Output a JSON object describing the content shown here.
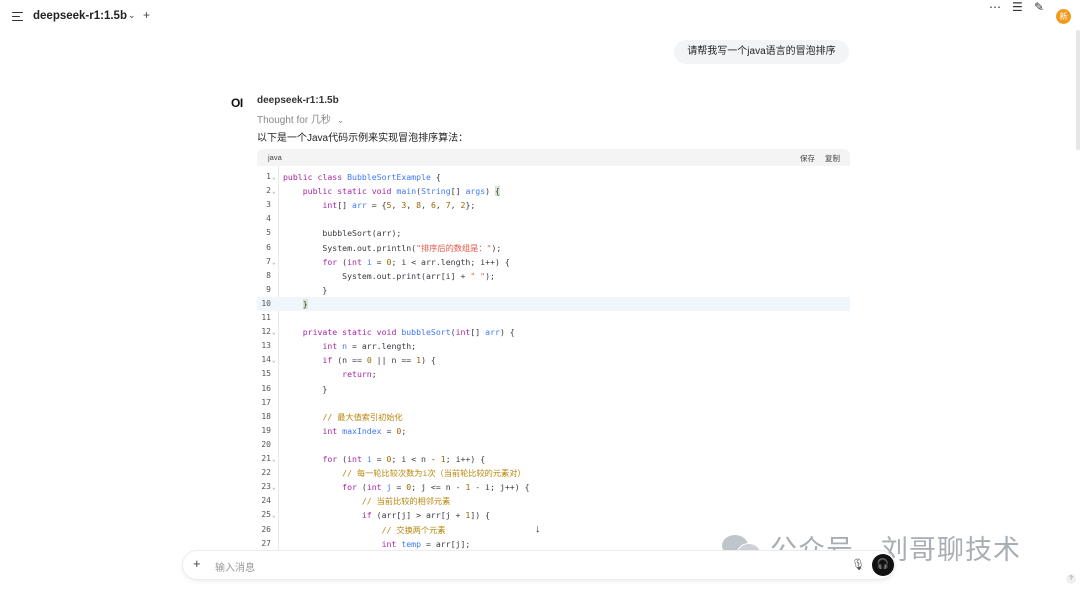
{
  "header": {
    "model_name": "deepseek-r1:1.5b",
    "avatar_initial": "新"
  },
  "chat": {
    "user_message": "请帮我写一个java语言的冒泡排序",
    "assistant": {
      "logo_text": "OI",
      "name": "deepseek-r1:1.5b",
      "thought": "Thought for 几秒",
      "intro": "以下是一个Java代码示例来实现冒泡排序算法："
    }
  },
  "code_block": {
    "language": "java",
    "save_label": "保存",
    "copy_label": "复制",
    "lines": [
      {
        "n": "1",
        "fold": true
      },
      {
        "n": "2",
        "fold": true
      },
      {
        "n": "3"
      },
      {
        "n": "4"
      },
      {
        "n": "5"
      },
      {
        "n": "6"
      },
      {
        "n": "7",
        "fold": true
      },
      {
        "n": "8"
      },
      {
        "n": "9"
      },
      {
        "n": "10",
        "highlight": true
      },
      {
        "n": "11"
      },
      {
        "n": "12",
        "fold": true
      },
      {
        "n": "13"
      },
      {
        "n": "14",
        "fold": true
      },
      {
        "n": "15"
      },
      {
        "n": "16"
      },
      {
        "n": "17"
      },
      {
        "n": "18"
      },
      {
        "n": "19"
      },
      {
        "n": "20"
      },
      {
        "n": "21",
        "fold": true
      },
      {
        "n": "22"
      },
      {
        "n": "23",
        "fold": true
      },
      {
        "n": "24"
      },
      {
        "n": "25",
        "fold": true
      },
      {
        "n": "26"
      },
      {
        "n": "27"
      }
    ],
    "code": [
      [
        [
          "k",
          "public "
        ],
        [
          "k",
          "class "
        ],
        [
          "t",
          "BubbleSortExample"
        ],
        [
          "f",
          " {"
        ]
      ],
      [
        [
          "f",
          "    "
        ],
        [
          "k",
          "public "
        ],
        [
          "k",
          "static "
        ],
        [
          "k",
          "void "
        ],
        [
          "t",
          "main"
        ],
        [
          "f",
          "("
        ],
        [
          "t",
          "String"
        ],
        [
          "f",
          "[] "
        ],
        [
          "t",
          "args"
        ],
        [
          "f",
          ") "
        ],
        [
          "cur",
          "{"
        ]
      ],
      [
        [
          "f",
          "        "
        ],
        [
          "k",
          "int"
        ],
        [
          "f",
          "[] "
        ],
        [
          "t",
          "arr"
        ],
        [
          "f",
          " = {"
        ],
        [
          "n",
          "5"
        ],
        [
          "f",
          ", "
        ],
        [
          "n",
          "3"
        ],
        [
          "f",
          ", "
        ],
        [
          "n",
          "8"
        ],
        [
          "f",
          ", "
        ],
        [
          "n",
          "6"
        ],
        [
          "f",
          ", "
        ],
        [
          "n",
          "7"
        ],
        [
          "f",
          ", "
        ],
        [
          "n",
          "2"
        ],
        [
          "f",
          "};"
        ]
      ],
      [],
      [
        [
          "f",
          "        bubbleSort(arr);"
        ]
      ],
      [
        [
          "f",
          "        System.out.println("
        ],
        [
          "s",
          "\"排序后的数组是：\""
        ],
        [
          "f",
          ");"
        ]
      ],
      [
        [
          "f",
          "        "
        ],
        [
          "k",
          "for "
        ],
        [
          "f",
          "("
        ],
        [
          "k",
          "int "
        ],
        [
          "t",
          "i"
        ],
        [
          "f",
          " = "
        ],
        [
          "n",
          "0"
        ],
        [
          "f",
          "; i < arr.length; i++) {"
        ]
      ],
      [
        [
          "f",
          "            System.out.print(arr[i] + "
        ],
        [
          "s",
          "\" \""
        ],
        [
          "f",
          ");"
        ]
      ],
      [
        [
          "f",
          "        }"
        ]
      ],
      [
        [
          "f",
          "    "
        ],
        [
          "cur",
          "}"
        ]
      ],
      [],
      [
        [
          "f",
          "    "
        ],
        [
          "k",
          "private "
        ],
        [
          "k",
          "static "
        ],
        [
          "k",
          "void "
        ],
        [
          "t",
          "bubbleSort"
        ],
        [
          "f",
          "("
        ],
        [
          "k",
          "int"
        ],
        [
          "f",
          "[] "
        ],
        [
          "t",
          "arr"
        ],
        [
          "f",
          ") {"
        ]
      ],
      [
        [
          "f",
          "        "
        ],
        [
          "k",
          "int "
        ],
        [
          "t",
          "n"
        ],
        [
          "f",
          " = arr.length;"
        ]
      ],
      [
        [
          "f",
          "        "
        ],
        [
          "k",
          "if "
        ],
        [
          "f",
          "(n == "
        ],
        [
          "n",
          "0"
        ],
        [
          "f",
          " || n == "
        ],
        [
          "n",
          "1"
        ],
        [
          "f",
          ") {"
        ]
      ],
      [
        [
          "f",
          "            "
        ],
        [
          "k",
          "return"
        ],
        [
          "f",
          ";"
        ]
      ],
      [
        [
          "f",
          "        }"
        ]
      ],
      [],
      [
        [
          "f",
          "        "
        ],
        [
          "c",
          "// 最大值索引初始化"
        ]
      ],
      [
        [
          "f",
          "        "
        ],
        [
          "k",
          "int "
        ],
        [
          "t",
          "maxIndex"
        ],
        [
          "f",
          " = "
        ],
        [
          "n",
          "0"
        ],
        [
          "f",
          ";"
        ]
      ],
      [],
      [
        [
          "f",
          "        "
        ],
        [
          "k",
          "for "
        ],
        [
          "f",
          "("
        ],
        [
          "k",
          "int "
        ],
        [
          "t",
          "i"
        ],
        [
          "f",
          " = "
        ],
        [
          "n",
          "0"
        ],
        [
          "f",
          "; i < n - "
        ],
        [
          "n",
          "1"
        ],
        [
          "f",
          "; i++) {"
        ]
      ],
      [
        [
          "f",
          "            "
        ],
        [
          "c",
          "// 每一轮比较次数为i次（当前轮比较的元素对）"
        ]
      ],
      [
        [
          "f",
          "            "
        ],
        [
          "k",
          "for "
        ],
        [
          "f",
          "("
        ],
        [
          "k",
          "int "
        ],
        [
          "t",
          "j"
        ],
        [
          "f",
          " = "
        ],
        [
          "n",
          "0"
        ],
        [
          "f",
          "; j <= n - "
        ],
        [
          "n",
          "1"
        ],
        [
          "f",
          " - i; j++) {"
        ]
      ],
      [
        [
          "f",
          "                "
        ],
        [
          "c",
          "// 当前比较的相邻元素"
        ]
      ],
      [
        [
          "f",
          "                "
        ],
        [
          "k",
          "if "
        ],
        [
          "f",
          "(arr[j] > arr[j + "
        ],
        [
          "n",
          "1"
        ],
        [
          "f",
          "]) {"
        ]
      ],
      [
        [
          "f",
          "                    "
        ],
        [
          "c",
          "// 交换两个元素"
        ]
      ],
      [
        [
          "f",
          "                    "
        ],
        [
          "k",
          "int "
        ],
        [
          "t",
          "temp"
        ],
        [
          "f",
          " = arr[j];"
        ]
      ]
    ]
  },
  "input": {
    "placeholder": "输入消息"
  },
  "watermark": {
    "text": "公众号 · 刘哥聊技术"
  },
  "help_label": "?",
  "icons": [
    "menu-icon",
    "chevron-down-icon",
    "plus-icon",
    "more-icon",
    "sliders-icon",
    "edit-icon",
    "mic-icon",
    "headphones-icon",
    "arrow-down-icon"
  ]
}
